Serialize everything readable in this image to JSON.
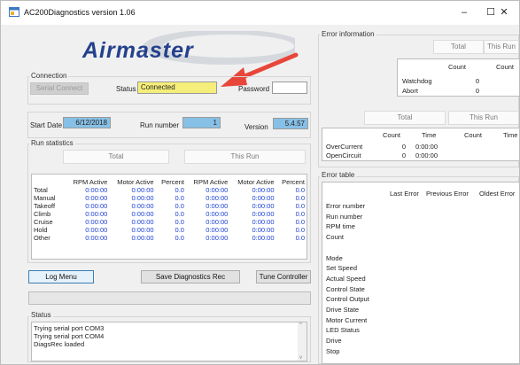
{
  "window": {
    "title": "AC200Diagnostics version 1.06",
    "min": "–",
    "max": "☐",
    "close": "✕"
  },
  "logo": {
    "text": "Airmaster"
  },
  "connection": {
    "label": "Connection",
    "serial_connect": "Serial Connect",
    "status_label": "Status",
    "status_value": "Connected",
    "password_label": "Password",
    "password_value": ""
  },
  "info": {
    "start_date_label": "Start Date",
    "start_date": "6/12/2018",
    "run_number_label": "Run number",
    "run_number": "1",
    "version_label": "Version",
    "version": "5.4.57"
  },
  "run_stats": {
    "label": "Run statistics",
    "total_hdr": "Total",
    "this_run_hdr": "This Run",
    "columns": [
      "RPM Active",
      "Motor Active",
      "Percent",
      "RPM Active",
      "Motor Active",
      "Percent"
    ],
    "rows": [
      {
        "name": "Total",
        "vals": [
          "0:00:00",
          "0:00:00",
          "0.0",
          "0:00:00",
          "0:00:00",
          "0.0"
        ]
      },
      {
        "name": "Manual",
        "vals": [
          "0:00:00",
          "0:00:00",
          "0.0",
          "0:00:00",
          "0:00:00",
          "0.0"
        ]
      },
      {
        "name": "Takeoff",
        "vals": [
          "0:00:00",
          "0:00:00",
          "0.0",
          "0:00:00",
          "0:00:00",
          "0.0"
        ]
      },
      {
        "name": "Climb",
        "vals": [
          "0:00:00",
          "0:00:00",
          "0.0",
          "0:00:00",
          "0:00:00",
          "0.0"
        ]
      },
      {
        "name": "Cruise",
        "vals": [
          "0:00:00",
          "0:00:00",
          "0.0",
          "0:00:00",
          "0:00:00",
          "0.0"
        ]
      },
      {
        "name": "Hold",
        "vals": [
          "0:00:00",
          "0:00:00",
          "0.0",
          "0:00:00",
          "0:00:00",
          "0.0"
        ]
      },
      {
        "name": "Other",
        "vals": [
          "0:00:00",
          "0:00:00",
          "0.0",
          "0:00:00",
          "0:00:00",
          "0.0"
        ]
      }
    ]
  },
  "buttons": {
    "log_menu": "Log Menu",
    "save_diag": "Save Diagnostics Rec",
    "tune": "Tune Controller"
  },
  "status_box": {
    "label": "Status",
    "lines": [
      "Trying serial port COM3",
      "Trying serial port COM4",
      "DiagsRec loaded"
    ]
  },
  "error_info": {
    "label": "Error information",
    "total_hdr": "Total",
    "this_run_hdr": "This Run",
    "count_hdr": "Count",
    "count_hdr2": "Count",
    "watchdog_label": "Watchdog",
    "watchdog_count": "0",
    "abort_label": "Abort",
    "abort_count": "0",
    "total_hdr2": "Total",
    "this_run_hdr2": "This Run",
    "col_count": "Count",
    "col_time": "Time",
    "col_count2": "Count",
    "col_time2": "Time",
    "overcurrent_label": "OverCurrent",
    "overcurrent_count": "0",
    "overcurrent_time": "0:00:00",
    "opencircuit_label": "OpenCircuit",
    "opencircuit_count": "0",
    "opencircuit_time": "0:00:00"
  },
  "error_table": {
    "label": "Error table",
    "columns": [
      "Last Error",
      "Previous Error",
      "Oldest Error"
    ],
    "rows": [
      "Error number",
      "Run number",
      "RPM time",
      "Count",
      "",
      "Mode",
      "Set Speed",
      "Actual Speed",
      "Control State",
      "Control Output",
      "Drive State",
      "Motor Current",
      "LED Status",
      "Drive",
      "Stop"
    ]
  },
  "colors": {
    "status_highlight": "#f5ee7a",
    "value_blue": "#1a3fd3",
    "field_blue": "#87c0e6",
    "arrow": "#e8463a"
  },
  "icons": {
    "app": "app-window-icon",
    "arrow": "red-arrow-annotation"
  }
}
